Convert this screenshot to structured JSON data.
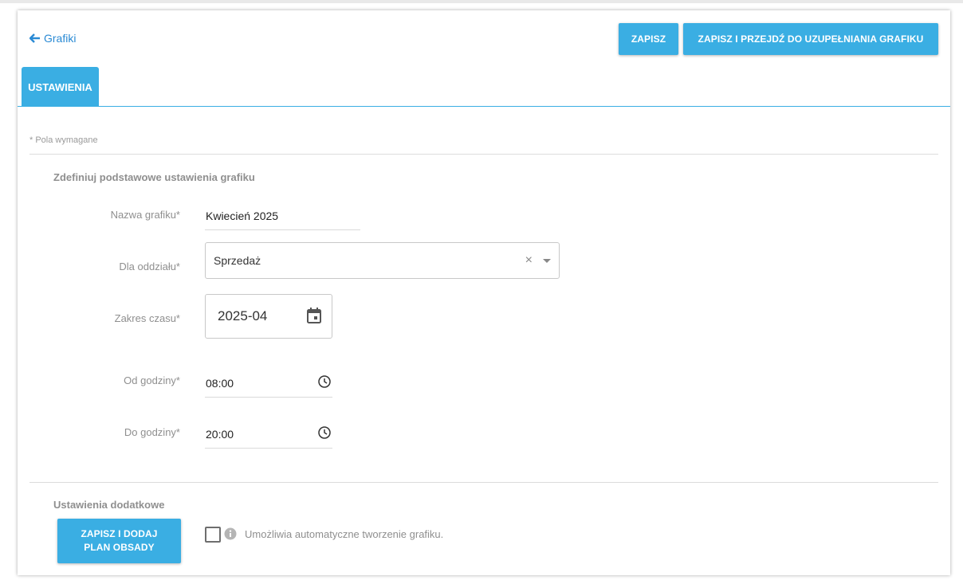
{
  "header": {
    "back_label": "Grafiki",
    "save_label": "ZAPISZ",
    "save_next_label": "ZAPISZ I PRZEJDŹ DO UZUPEŁNIANIA GRAFIKU"
  },
  "tabs": [
    {
      "label": "USTAWIENIA",
      "active": true
    }
  ],
  "required_note": "* Pola wymagane",
  "basic_section": {
    "title": "Zdefiniuj podstawowe ustawienia grafiku",
    "name": {
      "label": "Nazwa grafiku*",
      "value": "Kwiecień 2025"
    },
    "department": {
      "label": "Dla oddziału*",
      "value": "Sprzedaż",
      "clear_glyph": "×"
    },
    "range": {
      "label": "Zakres czasu*",
      "value": "2025-04",
      "icon": "calendar-icon"
    },
    "from": {
      "label": "Od godziny*",
      "value": "08:00",
      "icon": "clock-icon"
    },
    "to": {
      "label": "Do godziny*",
      "value": "20:00",
      "icon": "clock-icon"
    }
  },
  "extra_section": {
    "title": "Ustawienia dodatkowe",
    "plan_button_line1": "ZAPISZ I DODAJ",
    "plan_button_line2": "PLAN OBSADY",
    "auto_create": {
      "checked": false,
      "label": "Umożliwia automatyczne tworzenie grafiku.",
      "icon": "info-icon"
    }
  },
  "colors": {
    "accent": "#3aaee3",
    "link": "#2a8ad4",
    "muted_text": "#8f8f8f"
  }
}
